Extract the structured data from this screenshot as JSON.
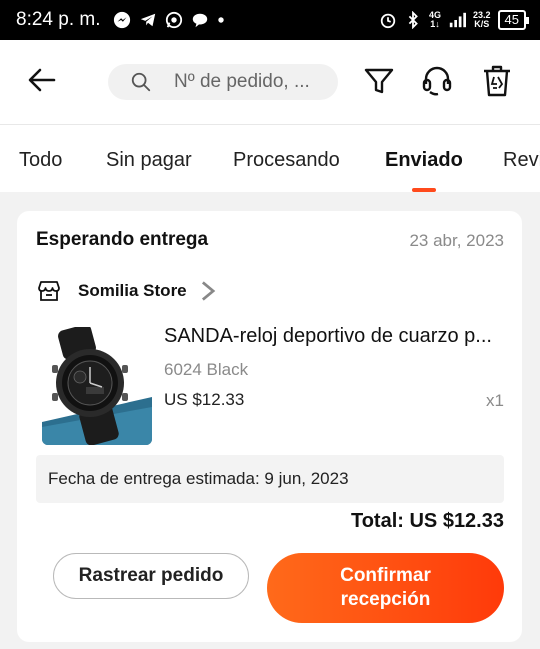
{
  "status_bar": {
    "time": "8:24 p. m.",
    "network_top": "4G",
    "network_bottom": "1↓",
    "speed_top": "23.2",
    "speed_bottom": "K/S",
    "battery": "45"
  },
  "header": {
    "search_placeholder": "Nº de pedido, ...",
    "icons": [
      "back-arrow-icon",
      "search-icon",
      "filter-icon",
      "headset-icon",
      "trash-icon"
    ]
  },
  "tabs": [
    {
      "label": "Todo",
      "active": false
    },
    {
      "label": "Sin pagar",
      "active": false
    },
    {
      "label": "Procesando",
      "active": false
    },
    {
      "label": "Enviado",
      "active": true
    },
    {
      "label": "Revi",
      "active": false
    }
  ],
  "accent_color": "#ff4a1c",
  "order": {
    "status": "Esperando entrega",
    "date": "23 abr, 2023",
    "store": "Somilia Store",
    "product": {
      "title": "SANDA-reloj deportivo de cuarzo p...",
      "variant": "6024 Black",
      "price": "US $12.33",
      "quantity": "x1"
    },
    "delivery_estimate": "Fecha de entrega estimada: 9 jun, 2023",
    "total": "Total: US $12.33",
    "track_button": "Rastrear pedido",
    "confirm_button": "Confirmar recepción"
  }
}
